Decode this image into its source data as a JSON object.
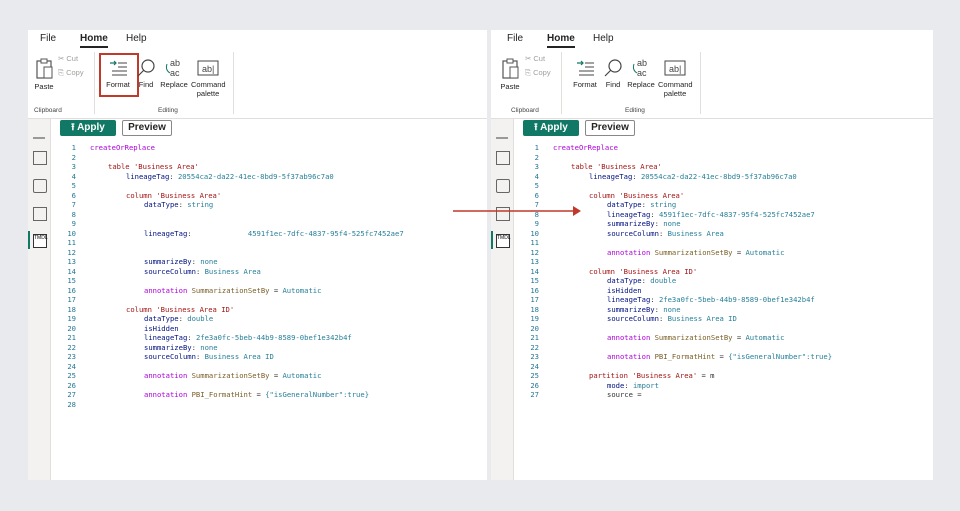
{
  "menu": {
    "file": "File",
    "home": "Home",
    "help": "Help"
  },
  "ribbon": {
    "paste": "Paste",
    "cut": "Cut",
    "copy": "Copy",
    "clipboard": "Clipboard",
    "format": "Format",
    "find": "Find",
    "replace": "Replace",
    "command": "Command",
    "palette": "palette",
    "editing": "Editing"
  },
  "toolbar": {
    "apply": "Apply",
    "preview": "Preview"
  },
  "left_code": [
    {
      "n": "1",
      "t": "createOrReplace"
    },
    {
      "n": "2",
      "t": ""
    },
    {
      "n": "3",
      "t": "table 'Business Area'"
    },
    {
      "n": "4",
      "t": "lineageTag: 20554ca2-da22-41ec-8bd9-5f37ab96c7a0"
    },
    {
      "n": "5",
      "t": ""
    },
    {
      "n": "6",
      "t": "column 'Business Area'"
    },
    {
      "n": "7",
      "t": "dataType: string"
    },
    {
      "n": "8",
      "t": ""
    },
    {
      "n": "9",
      "t": ""
    },
    {
      "n": "10",
      "t": "lineageTag:             4591f1ec-7dfc-4837-95f4-525fc7452ae7"
    },
    {
      "n": "11",
      "t": ""
    },
    {
      "n": "12",
      "t": ""
    },
    {
      "n": "13",
      "t": "summarizeBy: none"
    },
    {
      "n": "14",
      "t": "sourceColumn: Business Area"
    },
    {
      "n": "15",
      "t": ""
    },
    {
      "n": "16",
      "t": "annotation SummarizationSetBy = Automatic"
    },
    {
      "n": "17",
      "t": ""
    },
    {
      "n": "18",
      "t": "column 'Business Area ID'"
    },
    {
      "n": "19",
      "t": "dataType: double"
    },
    {
      "n": "20",
      "t": "isHidden"
    },
    {
      "n": "21",
      "t": "lineageTag: 2fe3a0fc-5beb-44b9-8589-0bef1e342b4f"
    },
    {
      "n": "22",
      "t": "summarizeBy: none"
    },
    {
      "n": "23",
      "t": "sourceColumn: Business Area ID"
    },
    {
      "n": "24",
      "t": ""
    },
    {
      "n": "25",
      "t": "annotation SummarizationSetBy = Automatic"
    },
    {
      "n": "26",
      "t": ""
    },
    {
      "n": "27",
      "t": "annotation PBI_FormatHint = {\"isGeneralNumber\":true}"
    },
    {
      "n": "28",
      "t": ""
    }
  ],
  "right_code": [
    {
      "n": "1",
      "t": "createOrReplace"
    },
    {
      "n": "2",
      "t": ""
    },
    {
      "n": "3",
      "t": "table 'Business Area'"
    },
    {
      "n": "4",
      "t": "lineageTag: 20554ca2-da22-41ec-8bd9-5f37ab96c7a0"
    },
    {
      "n": "5",
      "t": ""
    },
    {
      "n": "6",
      "t": "column 'Business Area'"
    },
    {
      "n": "7",
      "t": "dataType: string"
    },
    {
      "n": "8",
      "t": "lineageTag: 4591f1ec-7dfc-4837-95f4-525fc7452ae7"
    },
    {
      "n": "9",
      "t": "summarizeBy: none"
    },
    {
      "n": "10",
      "t": "sourceColumn: Business Area"
    },
    {
      "n": "11",
      "t": ""
    },
    {
      "n": "12",
      "t": "annotation SummarizationSetBy = Automatic"
    },
    {
      "n": "13",
      "t": ""
    },
    {
      "n": "14",
      "t": "column 'Business Area ID'"
    },
    {
      "n": "15",
      "t": "dataType: double"
    },
    {
      "n": "16",
      "t": "isHidden"
    },
    {
      "n": "17",
      "t": "lineageTag: 2fe3a0fc-5beb-44b9-8589-0bef1e342b4f"
    },
    {
      "n": "18",
      "t": "summarizeBy: none"
    },
    {
      "n": "19",
      "t": "sourceColumn: Business Area ID"
    },
    {
      "n": "20",
      "t": ""
    },
    {
      "n": "21",
      "t": "annotation SummarizationSetBy = Automatic"
    },
    {
      "n": "22",
      "t": ""
    },
    {
      "n": "23",
      "t": "annotation PBI_FormatHint = {\"isGeneralNumber\":true}"
    },
    {
      "n": "24",
      "t": ""
    },
    {
      "n": "25",
      "t": "partition 'Business Area' = m"
    },
    {
      "n": "26",
      "t": "mode: import"
    },
    {
      "n": "27",
      "t": "source ="
    }
  ],
  "colors": {
    "accent": "#117865",
    "highlight": "#c0392b"
  }
}
